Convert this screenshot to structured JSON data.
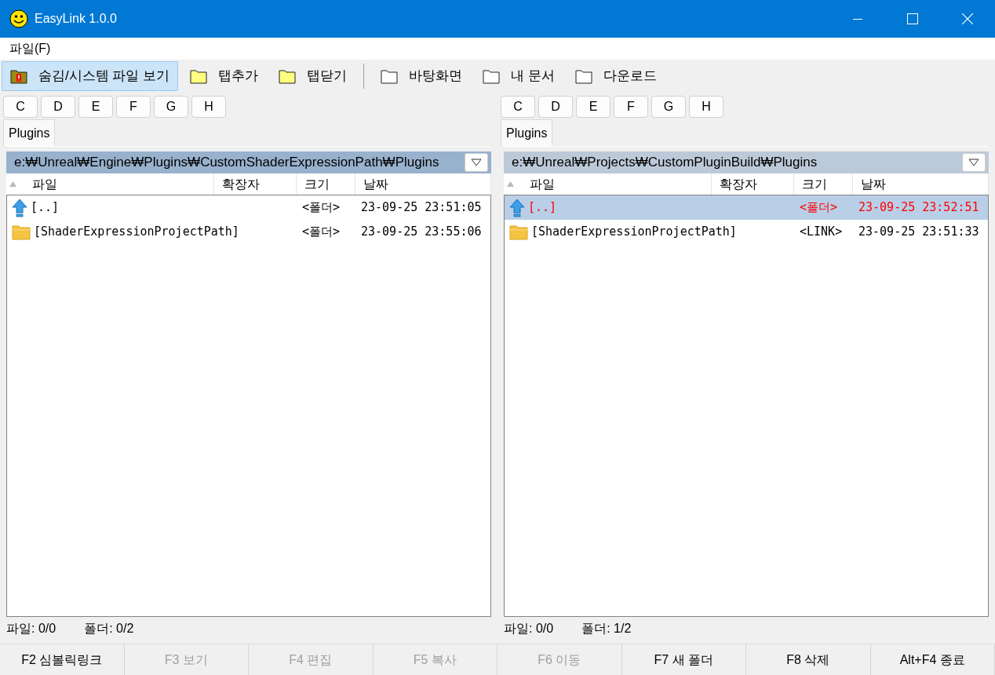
{
  "window": {
    "title": "EasyLink 1.0.0"
  },
  "menu": [
    "파일(F)"
  ],
  "toolbar": [
    {
      "kind": "toggle",
      "label": "숨김/시스템 파일 보기",
      "on": true
    },
    {
      "kind": "tab",
      "label": "탭추가",
      "on": false
    },
    {
      "kind": "tab",
      "label": "탭닫기",
      "on": false
    },
    {
      "kind": "separator"
    },
    {
      "kind": "shortcut",
      "label": "바탕화면",
      "on": false
    },
    {
      "kind": "shortcut",
      "label": "내 문서",
      "on": false
    },
    {
      "kind": "shortcut",
      "label": "다운로드",
      "on": false
    }
  ],
  "panes": [
    {
      "drives": [
        "C",
        "D",
        "E",
        "F",
        "G",
        "H"
      ],
      "tabs": [
        {
          "label": "Plugins",
          "selected": true
        }
      ],
      "path": "e:₩Unreal₩Engine₩Plugins₩CustomShaderExpressionPath₩Plugins",
      "active": true,
      "columns": [
        "파일",
        "확장자",
        "크기",
        "날짜"
      ],
      "rows": [
        {
          "kind": "parent",
          "name": "[..]",
          "size": "<폴더>",
          "date": "23-09-25 23:51:05",
          "selected": false
        },
        {
          "kind": "folder",
          "name": "[ShaderExpressionProjectPath]",
          "size": "<폴더>",
          "date": "23-09-25 23:55:06",
          "selected": false
        }
      ],
      "status": [
        "파일: 0/0",
        "폴더: 0/2"
      ]
    },
    {
      "drives": [
        "C",
        "D",
        "E",
        "F",
        "G",
        "H"
      ],
      "tabs": [
        {
          "label": "Plugins",
          "selected": true
        }
      ],
      "path": "e:₩Unreal₩Projects₩CustomPluginBuild₩Plugins",
      "active": false,
      "columns": [
        "파일",
        "확장자",
        "크기",
        "날짜"
      ],
      "rows": [
        {
          "kind": "parent",
          "name": "[..]",
          "size": "<폴더>",
          "date": "23-09-25 23:52:51",
          "selected": true
        },
        {
          "kind": "folder",
          "name": "[ShaderExpressionProjectPath]",
          "size": "<LINK>",
          "date": "23-09-25 23:51:33",
          "selected": false
        }
      ],
      "status": [
        "파일: 0/0",
        "폴더: 1/2"
      ]
    }
  ],
  "function_keys": [
    {
      "label": "F2 심볼릭링크",
      "disabled": false
    },
    {
      "label": "F3 보기",
      "disabled": true
    },
    {
      "label": "F4 편집",
      "disabled": true
    },
    {
      "label": "F5 복사",
      "disabled": true
    },
    {
      "label": "F6 이동",
      "disabled": true
    },
    {
      "label": "F7 새 폴더",
      "disabled": false
    },
    {
      "label": "F8 삭제",
      "disabled": false
    },
    {
      "label": "Alt+F4 종료",
      "disabled": false
    }
  ]
}
